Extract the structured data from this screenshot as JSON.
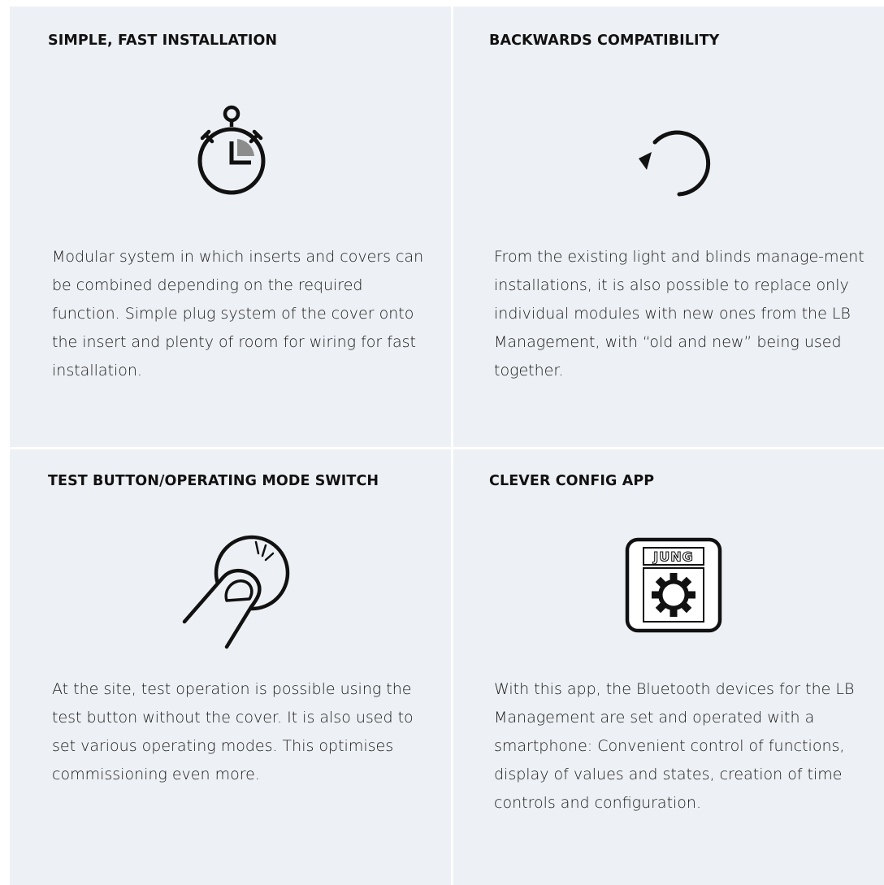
{
  "features": [
    {
      "title": "SIMPLE, FAST INSTALLATION",
      "icon": "stopwatch-icon",
      "description": "Modular system in which inserts and covers can be combined depending on the required function. Simple plug system of the cover onto the insert and plenty of room for wiring for fast installation."
    },
    {
      "title": "BACKWARDS COMPATIBILITY",
      "icon": "circular-arrow-icon",
      "description": "From the existing light and blinds manage-ment installations, it is also possible to replace only individual modules with new ones from the LB Management, with “old and new” being used together."
    },
    {
      "title": "TEST BUTTON/OPERATING MODE SWITCH",
      "icon": "finger-press-button-icon",
      "description": "At the site, test operation is possible using the test button without the cover. It is also used to set various operating modes. This optimises commissioning even more."
    },
    {
      "title": "CLEVER CONFIG APP",
      "icon": "jung-app-gear-icon",
      "icon_text": "JUNG",
      "description": "With this app, the Bluetooth devices for the LB Management are set and operated with a smartphone: Convenient control of functions, display of values and states, creation of time controls and configuration."
    }
  ],
  "colors": {
    "panel_background": "#edf0f4",
    "divider": "#ffffff",
    "text": "#111111",
    "icon_accent": "#8c8c8c"
  }
}
